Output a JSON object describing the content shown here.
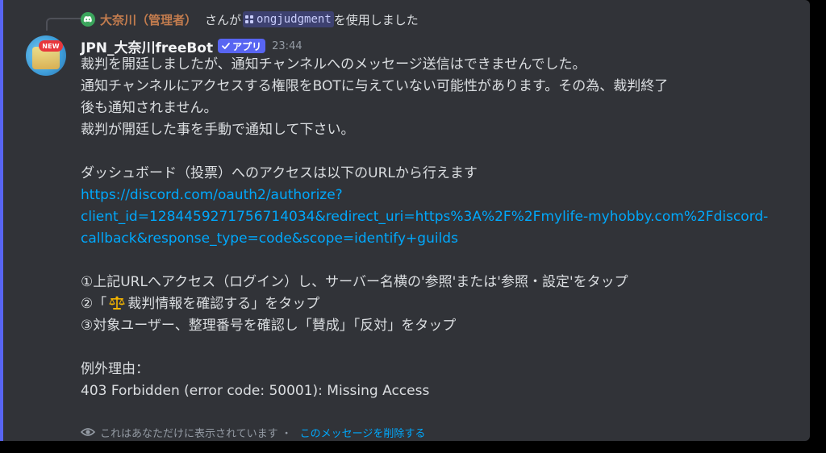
{
  "reply": {
    "username": "大奈川（管理者）",
    "text": "さんが",
    "command": "ongjudgment",
    "text_after": "を使用しました"
  },
  "message": {
    "bot_name": "JPN_大奈川freeBot",
    "app_tag": "アプリ",
    "timestamp": "23:44",
    "avatar_badge": "NEW",
    "lines": [
      "裁判を開廷しましたが、通知チャンネルへのメッセージ送信はできませんでした。",
      "通知チャンネルにアクセスする権限をBOTに与えていない可能性があります。その為、裁判終了",
      "後も通知されません。",
      "裁判が開廷した事を手動で通知して下さい。"
    ],
    "dashboard_heading": "ダッシュボード（投票）へのアクセスは以下のURLから行えます",
    "url_lines": [
      "https://discord.com/oauth2/authorize?",
      "client_id=1284459271756714034&redirect_uri=https%3A%2F%2Fmylife-myhobby.com%2Fdiscord-",
      "callback&response_type=code&scope=identify+guilds"
    ],
    "steps": {
      "step1": "①上記URLへアクセス（ログイン）し、サーバー名横の'参照'または'参照・設定'をタップ",
      "step2_prefix": "②「",
      "step2_text": "裁判情報を確認する」をタップ",
      "step3": "③対象ユーザー、整理番号を確認し「賛成」「反対」をタップ"
    },
    "exception_label": "例外理由：",
    "exception_text": "403 Forbidden (error code: 50001): Missing Access"
  },
  "footer": {
    "visibility_text": "これはあなただけに表示されています",
    "separator": "・",
    "dismiss_label": "このメッセージを削除する"
  },
  "colors": {
    "background": "#313338",
    "accent": "#5865f2",
    "link": "#00a8fc",
    "reply_user": "#c27c4e"
  }
}
